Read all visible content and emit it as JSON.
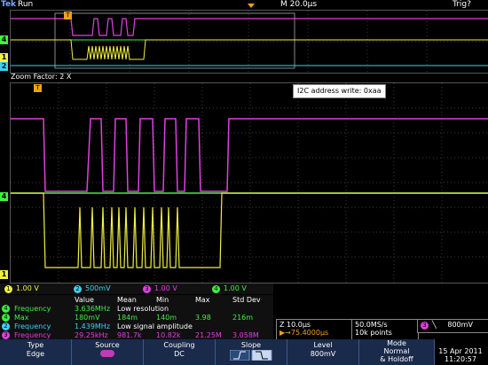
{
  "topbar": {
    "brand": "Tek",
    "status": "Run",
    "timebase": "M 20.0µs",
    "trig": "Trig?"
  },
  "zoom_bar": {
    "label": "Zoom Factor: 2 X"
  },
  "annotation": {
    "text": "I2C address write: 0xaa"
  },
  "channels": [
    {
      "num": "1",
      "value": "1.00 V",
      "color": "#f0f040"
    },
    {
      "num": "2",
      "value": "500mV",
      "color": "#40d0f0"
    },
    {
      "num": "3",
      "value": "1.00 V",
      "color": "#e040e0"
    },
    {
      "num": "4",
      "value": "1.00 V",
      "color": "#40f040"
    }
  ],
  "measurements": {
    "headers": [
      "Value",
      "Mean",
      "Min",
      "Max",
      "Std Dev"
    ],
    "rows": [
      {
        "ch": "4",
        "name": "Frequency",
        "value": "3.636MHz",
        "mean": "Low resolution",
        "min": "",
        "max": "",
        "std": "",
        "color": "#40f040"
      },
      {
        "ch": "4",
        "name": "Max",
        "value": "180mV",
        "mean": "184m",
        "min": "140m",
        "max": "3.98",
        "std": "216m",
        "color": "#40f040"
      },
      {
        "ch": "2",
        "name": "Frequency",
        "value": "1.439MHz",
        "mean": "Low signal amplitude",
        "min": "",
        "max": "",
        "std": "",
        "color": "#40d0f0"
      },
      {
        "ch": "3",
        "name": "Frequency",
        "value": "29.25kHz",
        "mean": "981.7k",
        "min": "10.82k",
        "max": "21.25M",
        "std": "3.058M",
        "color": "#e040e0"
      }
    ]
  },
  "zoom_info": {
    "line1": "Z 10.0µs",
    "line2": "▶→75.4000µs"
  },
  "sample_info": {
    "line1": "50.0MS/s",
    "line2": "10k points"
  },
  "trigger_info": {
    "ch": "3",
    "slope": "╲",
    "level": "800mV"
  },
  "date": {
    "line1": "15 Apr 2011",
    "line2": "11:20:57"
  },
  "menu": [
    {
      "label": "Type",
      "value": "Edge"
    },
    {
      "label": "Source",
      "value": ""
    },
    {
      "label": "Coupling",
      "value": "DC"
    },
    {
      "label": "Slope",
      "value": ""
    },
    {
      "label": "Level",
      "value": "800mV"
    },
    {
      "label": "Mode",
      "value": "Normal",
      "value2": "& Holdoff"
    }
  ],
  "colors": {
    "ch1": "#f0f040",
    "ch2": "#40d0f0",
    "ch3": "#e040e0",
    "ch4": "#40f040",
    "menu": "#1a2a4a"
  }
}
